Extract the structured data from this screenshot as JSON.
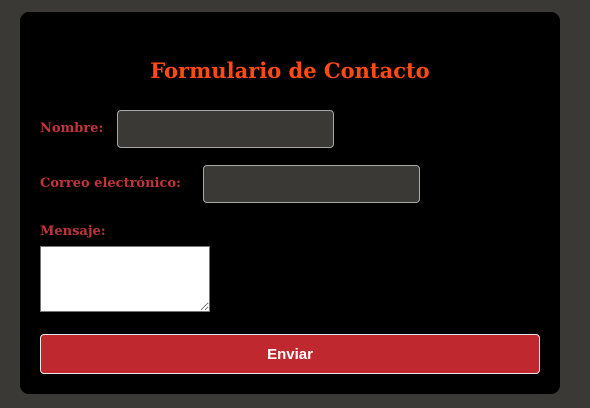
{
  "form": {
    "title": "Formulario de Contacto",
    "name_label": "Nombre:",
    "name_value": "",
    "email_label": "Correo electrónico:",
    "email_value": "",
    "message_label": "Mensaje:",
    "message_value": "",
    "submit_label": "Enviar"
  },
  "colors": {
    "page_background": "#3a3935",
    "card_background": "#000000",
    "title": "#ff4a12",
    "label": "#c0353a",
    "input_background": "#3a3935",
    "button_background": "#c0282f",
    "button_text": "#ffffff"
  }
}
